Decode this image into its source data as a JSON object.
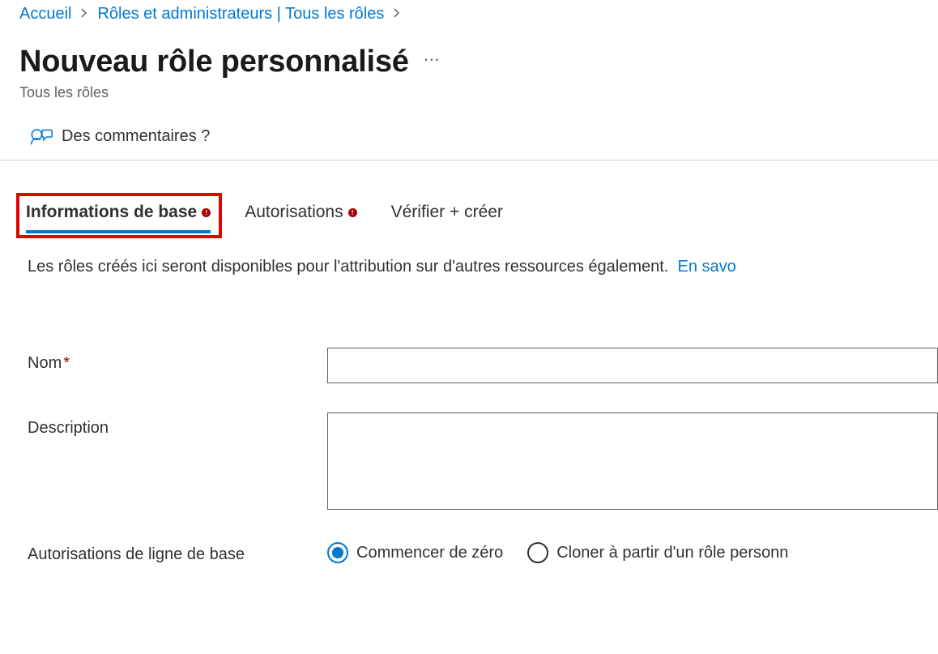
{
  "breadcrumb": {
    "home": "Accueil",
    "roles": "Rôles et administrateurs | Tous les rôles"
  },
  "header": {
    "title": "Nouveau rôle personnalisé",
    "subtitle": "Tous les rôles"
  },
  "toolbar": {
    "feedback": "Des commentaires ?"
  },
  "tabs": {
    "basics": "Informations de base",
    "permissions": "Autorisations",
    "review": "Vérifier + créer"
  },
  "info": {
    "text": "Les rôles créés ici seront disponibles pour l'attribution sur d'autres ressources également.",
    "link": "En savo"
  },
  "form": {
    "name_label": "Nom",
    "name_value": "",
    "description_label": "Description",
    "description_value": "",
    "baseline_label": "Autorisations de ligne de base",
    "radio_start": "Commencer de zéro",
    "radio_clone": "Cloner à partir d'un rôle personn"
  }
}
